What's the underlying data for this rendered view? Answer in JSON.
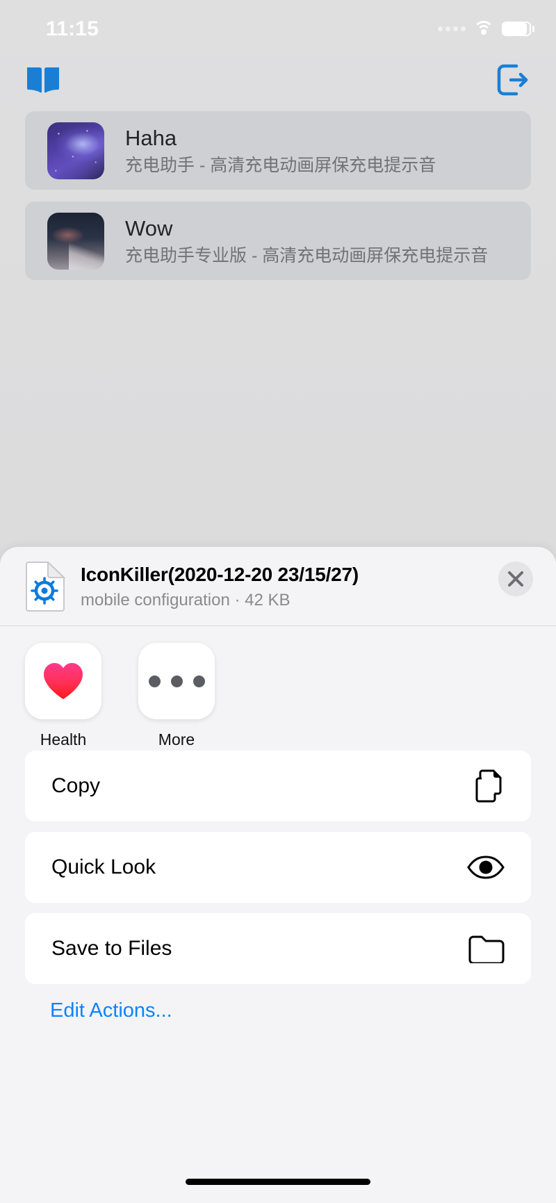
{
  "status_bar": {
    "time": "11:15",
    "signal_icon": "signal-dots-icon",
    "wifi_icon": "wifi-icon",
    "battery_icon": "battery-full-icon"
  },
  "toolbar": {
    "library_icon": "open-book-icon",
    "export_icon": "export-share-icon",
    "accent_color": "#1a7fd4"
  },
  "list": {
    "items": [
      {
        "title": "Haha",
        "subtitle": "充电助手 - 高清充电动画屏保充电提示音",
        "thumb_style": "galaxy"
      },
      {
        "title": "Wow",
        "subtitle": "充电助手专业版 - 高清充电动画屏保充电提示音",
        "thumb_style": "night"
      }
    ]
  },
  "share_sheet": {
    "file": {
      "name": "IconKiller(2020-12-20 23/15/27)",
      "subtitle": "mobile configuration · 42 KB",
      "icon": "mobileconfig-document-icon",
      "icon_accent": "#0b7bdc"
    },
    "close_button": {
      "icon": "close-x-icon",
      "label": "Close"
    },
    "apps": [
      {
        "label": "Health",
        "icon": "heart-icon",
        "color": "#ff2d55"
      },
      {
        "label": "More",
        "icon": "ellipsis-icon",
        "color": "#5c5c63"
      }
    ],
    "actions": [
      {
        "label": "Copy",
        "icon": "copy-documents-icon"
      },
      {
        "label": "Quick Look",
        "icon": "eye-icon"
      },
      {
        "label": "Save to Files",
        "icon": "folder-icon"
      }
    ],
    "edit_actions_label": "Edit Actions...",
    "link_color": "#0b84ff"
  }
}
